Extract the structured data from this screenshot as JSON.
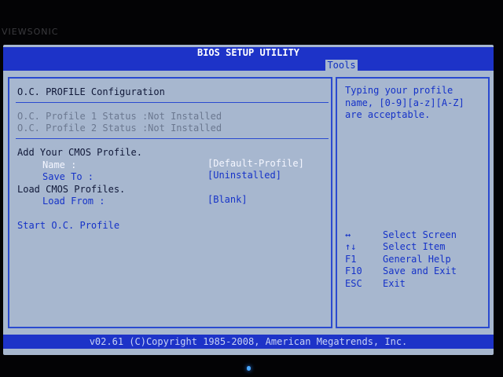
{
  "monitor": {
    "logo": "VIEWSONIC"
  },
  "bios": {
    "title": "BIOS SETUP UTILITY",
    "active_tab": "Tools",
    "main": {
      "section_title": "O.C. PROFILE Configuration",
      "profile1_status": "O.C. Profile 1 Status :Not Installed",
      "profile2_status": "O.C. Profile 2 Status :Not Installed",
      "add_cmos_heading": "Add Your CMOS Profile.",
      "name_label": "Name :",
      "name_value": "[Default-Profile]",
      "save_to_label": "Save To :",
      "save_to_value": "[Uninstalled]",
      "load_cmos_heading": "Load CMOS Profiles.",
      "load_from_label": "Load From :",
      "load_from_value": "[Blank]",
      "start_oc_profile": "Start O.C. Profile"
    },
    "help": {
      "line1": "Typing your profile",
      "line2": "name, [0-9][a-z][A-Z]",
      "line3": "are acceptable.",
      "keys": [
        {
          "key": "↔",
          "action": "Select Screen"
        },
        {
          "key": "↑↓",
          "action": "Select Item"
        },
        {
          "key": "F1",
          "action": "General Help"
        },
        {
          "key": "F10",
          "action": "Save and Exit"
        },
        {
          "key": "ESC",
          "action": "Exit"
        }
      ]
    },
    "footer": "v02.61 (C)Copyright 1985-2008, American Megatrends, Inc."
  }
}
